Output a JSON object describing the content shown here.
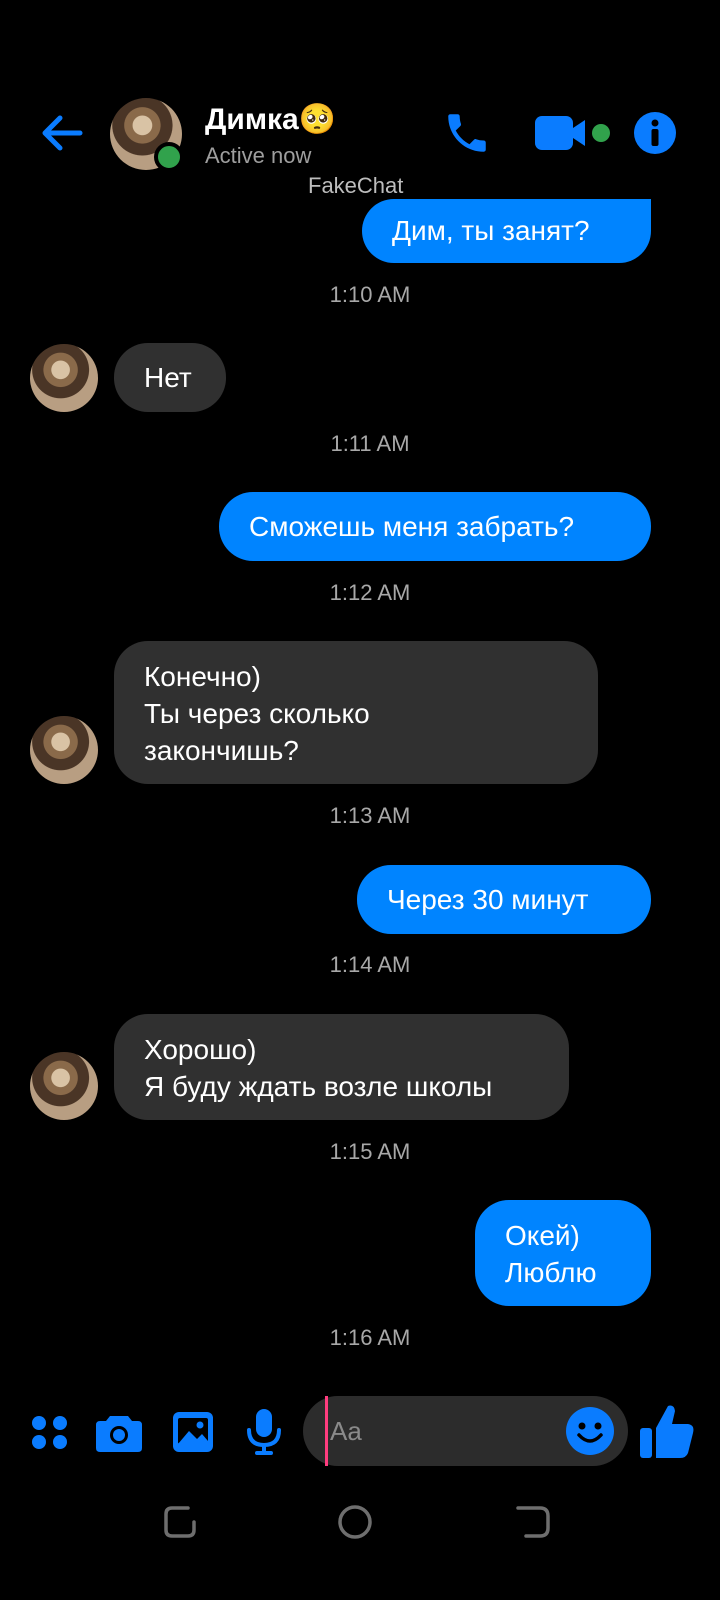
{
  "header": {
    "contact_name": "Димка🥺",
    "status": "Active now",
    "watermark": "FakeChat"
  },
  "composer": {
    "placeholder": "Aa",
    "value": ""
  },
  "messages": [
    {
      "side": "out",
      "text": "Дим, ты занят?",
      "time": "1:10 AM"
    },
    {
      "side": "in",
      "text": "Нет",
      "time": "1:11 AM"
    },
    {
      "side": "out",
      "text": "Сможешь меня забрать?",
      "time": "1:12 AM"
    },
    {
      "side": "in",
      "text": "Конечно)\nТы через сколько\nзакончишь?",
      "time": "1:13 AM"
    },
    {
      "side": "out",
      "text": "Через 30 минут",
      "time": "1:14 AM"
    },
    {
      "side": "in",
      "text": "Хорошо)\nЯ буду ждать возле школы",
      "time": "1:15 AM"
    },
    {
      "side": "out",
      "text": "Окей)\nЛюблю",
      "time": "1:16 AM"
    }
  ],
  "icons": {
    "back": "arrow-left-icon",
    "call": "phone-icon",
    "video": "video-camera-icon",
    "info": "info-icon",
    "apps": "four-dots-icon",
    "camera": "camera-icon",
    "gallery": "image-icon",
    "mic": "microphone-icon",
    "emoji": "smiley-icon",
    "like": "thumbs-up-icon"
  },
  "colors": {
    "accent": "#0084ff",
    "incoming_bubble": "#303030",
    "online": "#31a24c",
    "background": "#000000"
  }
}
